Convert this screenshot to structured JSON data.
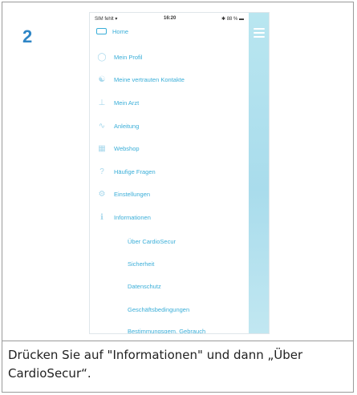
{
  "step": {
    "number": "2"
  },
  "caption": {
    "text": "Drücken Sie auf \"Informationen\" und dann „Über CardioSecur“."
  },
  "status_bar": {
    "carrier": "SIM fehlt ▾",
    "time": "16:20",
    "battery": "✱ 88 % ▬"
  },
  "menu": {
    "home": "Home",
    "items": [
      {
        "label": "Mein Profil",
        "icon": "person-icon"
      },
      {
        "label": "Meine vertrauten Kontakte",
        "icon": "contacts-icon"
      },
      {
        "label": "Mein Arzt",
        "icon": "doctor-icon"
      },
      {
        "label": "Anleitung",
        "icon": "guide-icon"
      },
      {
        "label": "Webshop",
        "icon": "cart-icon"
      },
      {
        "label": "Häufige Fragen",
        "icon": "question-icon"
      },
      {
        "label": "Einstellungen",
        "icon": "gear-icon"
      },
      {
        "label": "Informationen",
        "icon": "info-icon"
      }
    ],
    "sub_items": [
      {
        "label": "Über CardioSecur"
      },
      {
        "label": "Sicherheit"
      },
      {
        "label": "Datenschutz"
      },
      {
        "label": "Geschäftsbedingungen"
      },
      {
        "label": "Bestimmungsgem. Gebrauch"
      }
    ]
  }
}
